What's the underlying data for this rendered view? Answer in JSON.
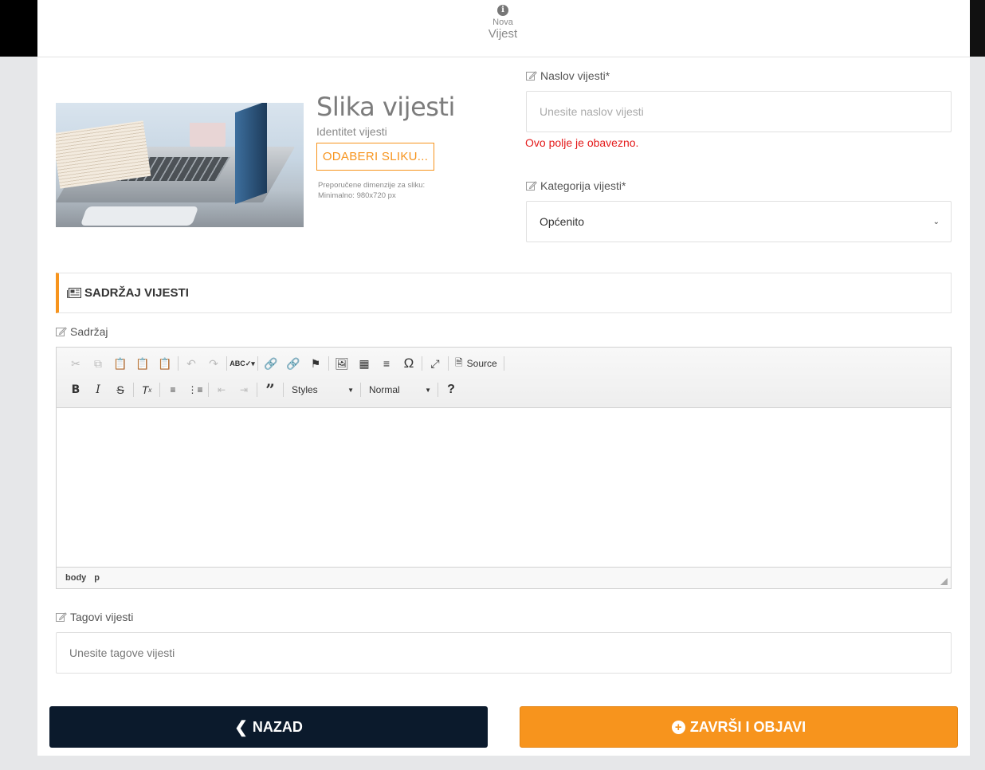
{
  "header": {
    "step_small": "Nova",
    "step_big": "Vijest"
  },
  "image_section": {
    "title": "Slika vijesti",
    "subtitle": "Identitet vijesti",
    "pick_button": "ODABERI SLIKU...",
    "note_line1": "Preporučene dimenzije za sliku:",
    "note_line2": "Minimalno: 980x720 px"
  },
  "title_field": {
    "label": "Naslov vijesti*",
    "placeholder": "Unesite naslov vijesti",
    "error": "Ovo polje je obavezno."
  },
  "category_field": {
    "label": "Kategorija vijesti*",
    "value": "Općenito"
  },
  "content_section": {
    "heading": "SADRŽAJ VIJESTI",
    "label": "Sadržaj"
  },
  "editor": {
    "source_label": "Source",
    "styles_label": "Styles",
    "format_label": "Normal",
    "path": [
      "body",
      "p"
    ]
  },
  "tags_field": {
    "label": "Tagovi vijesti",
    "placeholder": "Unesite tagove vijesti"
  },
  "buttons": {
    "back": "NAZAD",
    "publish": "ZAVRŠI I OBJAVI"
  },
  "colors": {
    "accent": "#f7941d",
    "dark": "#0b1a2c",
    "error": "#e41b1b"
  }
}
